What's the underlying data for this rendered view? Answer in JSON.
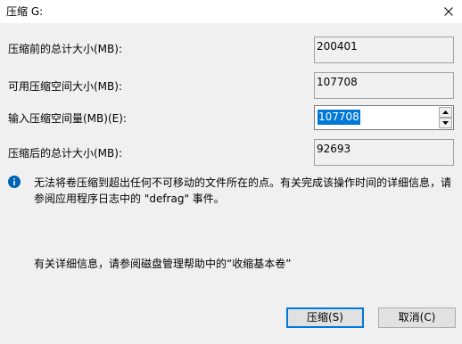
{
  "window": {
    "title": "压缩 G:"
  },
  "fields": {
    "total_before_label": "压缩前的总计大小(MB):",
    "total_before_value": "200401",
    "available_label": "可用压缩空间大小(MB):",
    "available_value": "107708",
    "amount_label": "输入压缩空间量(MB)(E):",
    "amount_value": "107708",
    "total_after_label": "压缩后的总计大小(MB):",
    "total_after_value": "92693"
  },
  "info": {
    "icon": "info-icon",
    "message": "无法将卷压缩到超出任何不可移动的文件所在的点。有关完成该操作时间的详细信息，请参阅应用程序日志中的 \"defrag\" 事件。"
  },
  "help": {
    "text": "有关详细信息，请参阅磁盘管理帮助中的“收缩基本卷”"
  },
  "buttons": {
    "shrink_label": "压缩(S)",
    "cancel_label": "取消(C)"
  },
  "colors": {
    "accent": "#0078d7",
    "background": "#f0f0f0",
    "titlebar": "#ffffff"
  }
}
